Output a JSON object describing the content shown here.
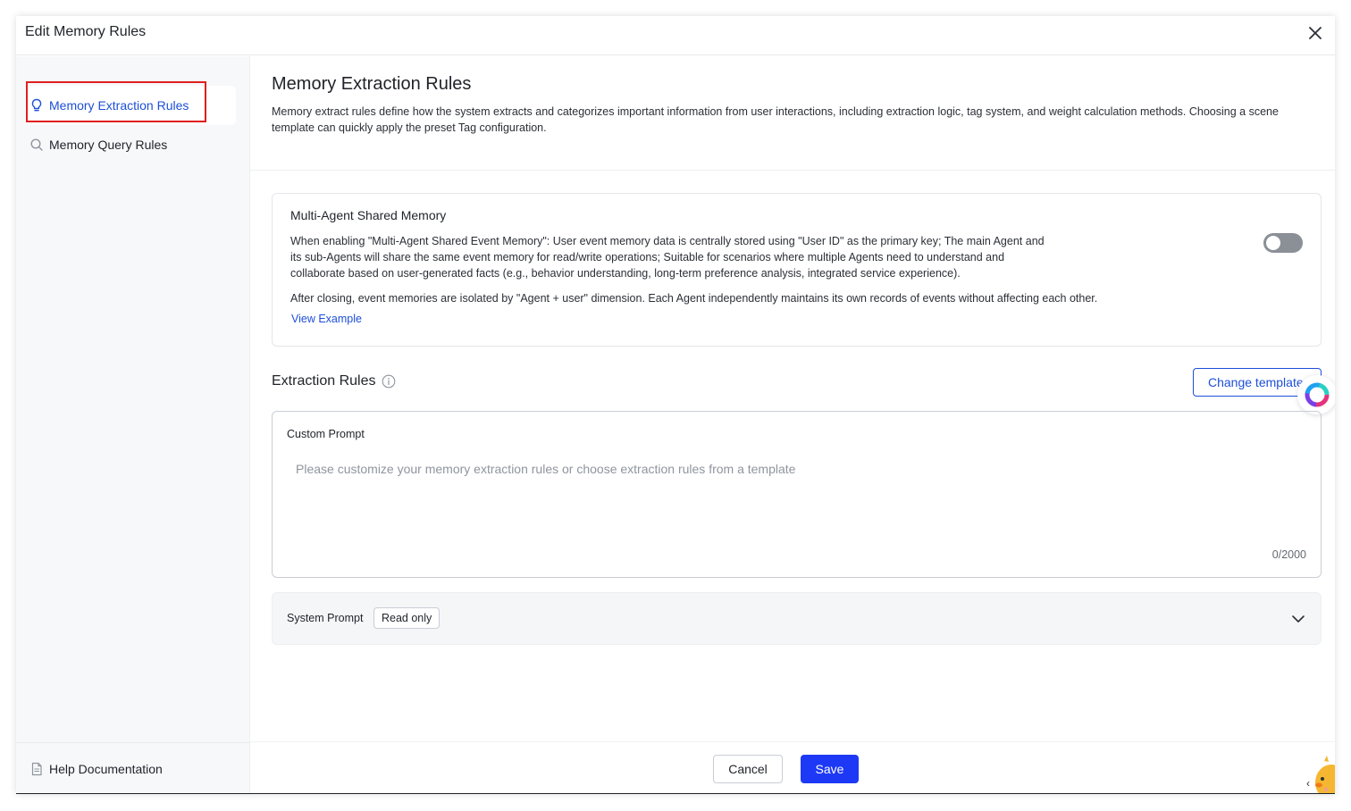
{
  "dialog": {
    "title": "Edit Memory Rules",
    "close_icon": "close-icon"
  },
  "sidebar": {
    "items": [
      {
        "label": "Memory Extraction Rules",
        "icon": "lightbulb-icon",
        "active": true
      },
      {
        "label": "Memory Query Rules",
        "icon": "search-icon",
        "active": false
      }
    ],
    "footer": {
      "label": "Help Documentation",
      "icon": "document-icon"
    }
  },
  "main": {
    "title": "Memory Extraction Rules",
    "description": "Memory extract rules define how the system extracts and categorizes important information from user interactions, including extraction logic, tag system, and weight calculation methods. Choosing a scene template can quickly apply the preset Tag configuration.",
    "shared_memory": {
      "title": "Multi-Agent Shared Memory",
      "text1": "When enabling \"Multi-Agent Shared Event Memory\": User event memory data is centrally stored using \"User ID\" as the primary key; The main Agent and its sub-Agents will share the same event memory for read/write operations; Suitable for scenarios where multiple Agents need to understand and collaborate based on user-generated facts (e.g., behavior understanding, long-term preference analysis, integrated service experience).",
      "text2": "After closing, event memories are isolated by \"Agent + user\" dimension. Each Agent independently maintains its own records of events without affecting each other.",
      "link": "View Example",
      "enabled": false
    },
    "extraction_rules": {
      "title": "Extraction Rules",
      "change_template_label": "Change template",
      "custom_prompt": {
        "label": "Custom Prompt",
        "placeholder": "Please customize your memory extraction rules or choose extraction rules from a template",
        "value": "",
        "count": "0/2000"
      },
      "system_prompt": {
        "label": "System Prompt",
        "tag": "Read only"
      }
    }
  },
  "footer": {
    "cancel_label": "Cancel",
    "save_label": "Save"
  },
  "colors": {
    "accent": "#1d4fd8",
    "save_button": "#1d39f5",
    "highlight_box": "#e01f1f"
  }
}
